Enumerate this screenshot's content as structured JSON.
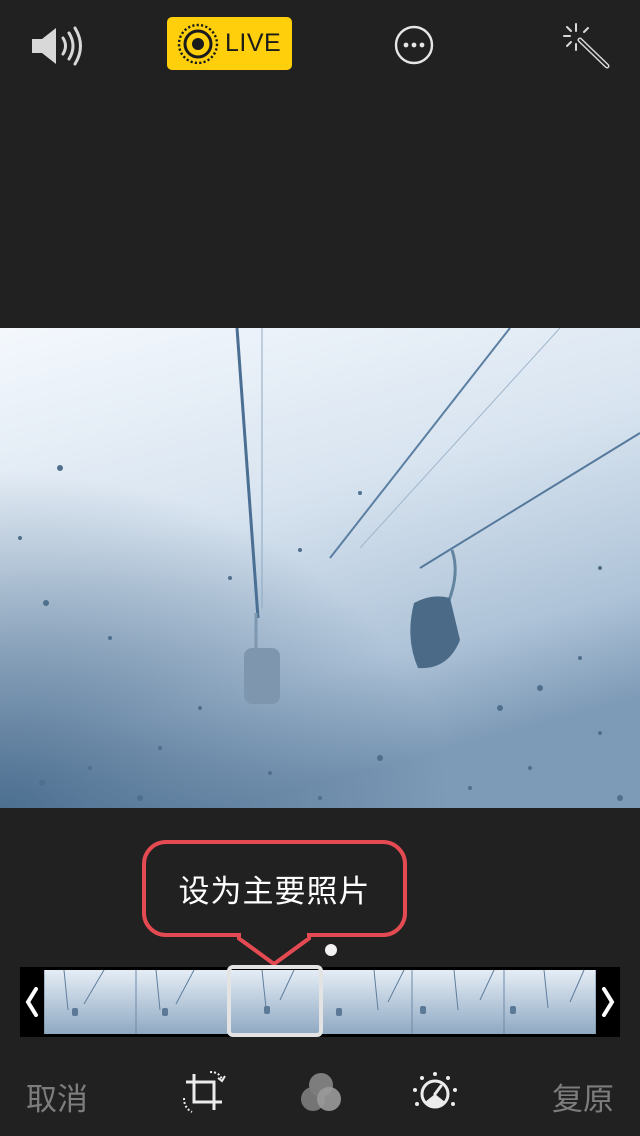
{
  "topbar": {
    "live_label": "LIVE",
    "icons": [
      "speaker-icon",
      "live-photo-icon",
      "more-icon",
      "auto-enhance-wand-icon"
    ]
  },
  "photo": {
    "description_icon": "photo-canvas"
  },
  "keyframe": {
    "tooltip": "设为主要照片"
  },
  "bottombar": {
    "cancel_label": "取消",
    "revert_label": "复原",
    "tools": [
      "crop-rotate-icon",
      "filters-icon",
      "adjust-icon"
    ]
  },
  "colors": {
    "background": "#212121",
    "live_badge": "#fecf0a",
    "tooltip_border": "#e44a52",
    "disabled_text": "#7d7d7d"
  }
}
